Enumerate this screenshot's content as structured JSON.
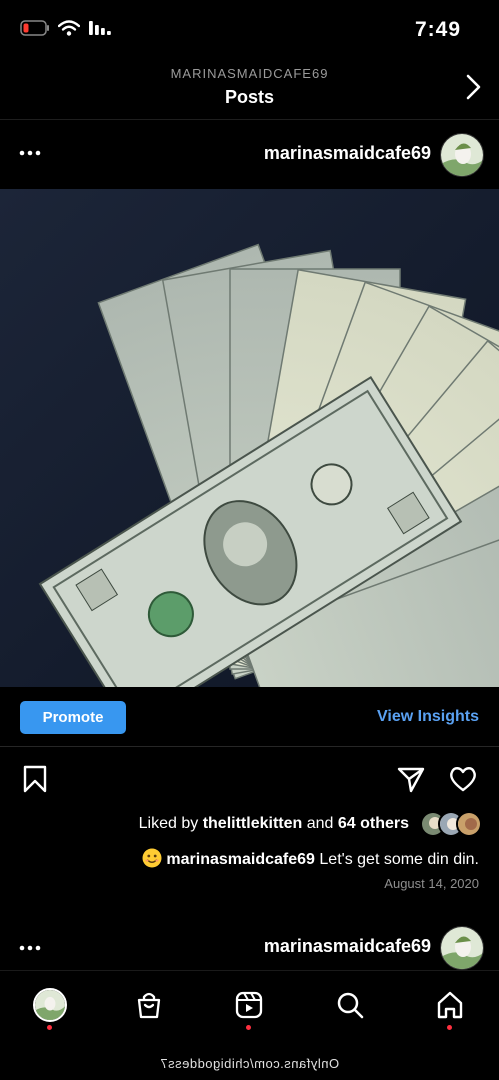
{
  "status_bar": {
    "time": "7:49"
  },
  "header": {
    "account": "MARINASMAIDCAFE69",
    "title": "Posts"
  },
  "post": {
    "username": "marinasmaidcafe69",
    "image_description": "fan of US one-dollar bills",
    "promote_label": "Promote",
    "insights_label": "View Insights",
    "likes": {
      "prefix": "Liked by ",
      "liker": "thelittlekitten",
      "middle": " and ",
      "others": "64 others"
    },
    "caption": {
      "username": "marinasmaidcafe69",
      "text": " Let's get some din din."
    },
    "date": "August 14, 2020"
  },
  "next_post": {
    "username": "marinasmaidcafe69"
  },
  "nav": {
    "items": [
      "profile",
      "shop",
      "reels",
      "search",
      "home"
    ]
  },
  "watermark": "Onlyfans.com/chibigoddess7",
  "colors": {
    "accent": "#3897f0",
    "link": "#5aa1f2",
    "notification": "#ff3040"
  }
}
